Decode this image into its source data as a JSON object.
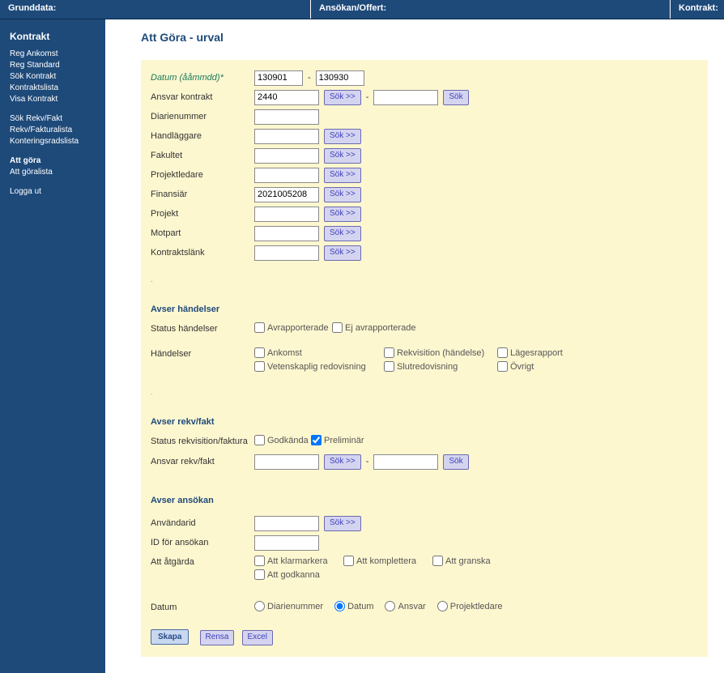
{
  "topbar": {
    "left": "Grunddata:",
    "mid": "Ansökan/Offert:",
    "right": "Kontrakt:"
  },
  "sidebar": {
    "heading": "Kontrakt",
    "group1": [
      "Reg Ankomst",
      "Reg Standard",
      "Sök Kontrakt",
      "Kontraktslista",
      "Visa Kontrakt"
    ],
    "group2": [
      "Sök Rekv/Fakt",
      "Rekv/Fakturalista",
      "Konteringsradslista"
    ],
    "group3_bold": "Att göra",
    "group3_items": [
      "Att göralista"
    ],
    "group4": [
      "Logga ut"
    ]
  },
  "page": {
    "title": "Att Göra - urval"
  },
  "labels": {
    "datum": "Datum (ååmmdd)*",
    "ansvar_kontrakt": "Ansvar kontrakt",
    "diarienummer": "Diarienummer",
    "handlaggare": "Handläggare",
    "fakultet": "Fakultet",
    "projektledare": "Projektledare",
    "finansiar": "Finansiär",
    "projekt": "Projekt",
    "motpart": "Motpart",
    "kontraktslank": "Kontraktslänk",
    "status_handelser": "Status händelser",
    "handelser": "Händelser",
    "status_rekv": "Status rekvisition/faktura",
    "ansvar_rekv": "Ansvar rekv/fakt",
    "anvandarid": "Användarid",
    "id_ansokan": "ID för ansökan",
    "att_atgarda": "Att åtgärda",
    "datum_sort": "Datum"
  },
  "sections": {
    "handelser": "Avser händelser",
    "rekv": "Avser rekv/fakt",
    "ansokan": "Avser ansökan"
  },
  "values": {
    "datum_from": "130901",
    "datum_to": "130930",
    "ansvar_kontrakt": "2440",
    "ansvar_kontrakt2": "",
    "diarienummer": "",
    "handlaggare": "",
    "fakultet": "",
    "projektledare": "",
    "finansiar": "2021005208",
    "projekt": "",
    "motpart": "",
    "kontraktslank": "",
    "ansvar_rekv": "",
    "ansvar_rekv2": "",
    "anvandarid": "",
    "id_ansokan": ""
  },
  "checkboxes": {
    "avrapporterade": "Avrapporterade",
    "ej_avrapporterade": "Ej avrapporterade",
    "ankomst": "Ankomst",
    "rekvisition_h": "Rekvisition (händelse)",
    "lagesrapport": "Lägesrapport",
    "vetenskaplig": "Vetenskaplig redovisning",
    "slutredovisning": "Slutredovisning",
    "ovrigt": "Övrigt",
    "godkanda": "Godkända",
    "preliminar": "Preliminär",
    "att_klarmarkera": "Att klarmarkera",
    "att_komplettera": "Att komplettera",
    "att_granska": "Att granska",
    "att_godkanna": "Att godkanna"
  },
  "radios": {
    "diarienummer": "Diarienummer",
    "datum": "Datum",
    "ansvar": "Ansvar",
    "projektledare": "Projektledare"
  },
  "buttons": {
    "sok_expand": "Sök >>",
    "sok": "Sök",
    "skapa": "Skapa",
    "rensa": "Rensa",
    "excel": "Excel"
  }
}
